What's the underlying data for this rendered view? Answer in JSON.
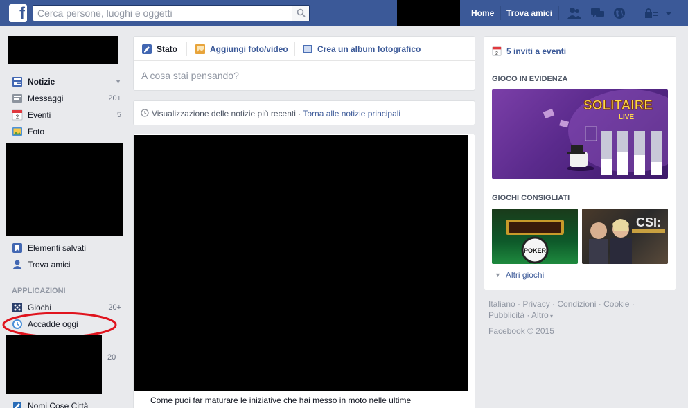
{
  "topbar": {
    "logo": "f",
    "search_placeholder": "Cerca persone, luoghi e oggetti",
    "nav": {
      "home": "Home",
      "find_friends": "Trova amici"
    }
  },
  "left": {
    "items": [
      {
        "label": "Notizie",
        "count": "",
        "icon": "news-feed-icon"
      },
      {
        "label": "Messaggi",
        "count": "20+",
        "icon": "messages-icon"
      },
      {
        "label": "Eventi",
        "count": "5",
        "icon": "events-icon"
      },
      {
        "label": "Foto",
        "count": "",
        "icon": "photos-icon"
      }
    ],
    "items2": [
      {
        "label": "Elementi salvati",
        "icon": "saved-icon"
      },
      {
        "label": "Trova amici",
        "icon": "find-friends-icon"
      }
    ],
    "apps_header": "APPLICAZIONI",
    "apps": [
      {
        "label": "Giochi",
        "count": "20+",
        "icon": "games-icon"
      },
      {
        "label": "Accadde oggi",
        "count": "",
        "icon": "on-this-day-icon"
      }
    ],
    "hidden_count": "20+",
    "last_item": "Nomi Cose Città"
  },
  "composer": {
    "tabs": {
      "status": "Stato",
      "photo": "Aggiungi foto/video",
      "album": "Crea un album fotografico"
    },
    "placeholder": "A cosa stai pensando?"
  },
  "sortbar": {
    "text": "Visualizzazione delle notizie più recenti · ",
    "link": "Torna alle notizie principali"
  },
  "post": {
    "text": "Come puoi far maturare le iniziative che hai messo in moto nelle ultime"
  },
  "right": {
    "events": "5 inviti a eventi",
    "featured_head": "GIOCO IN EVIDENZA",
    "featured_title": "SOLITAIRE",
    "featured_sub": "LIVE",
    "suggested_head": "GIOCHI CONSIGLIATI",
    "game1_text": "POKER",
    "game2_text": "CSI:",
    "more_games": "Altri giochi"
  },
  "footer": {
    "links": [
      "Italiano",
      "Privacy",
      "Condizioni",
      "Cookie",
      "Pubblicità",
      "Altro"
    ],
    "copyright": "Facebook © 2015"
  },
  "colors": {
    "brand": "#3b5998",
    "background": "#e9eaed",
    "annotation": "#e0141e"
  }
}
